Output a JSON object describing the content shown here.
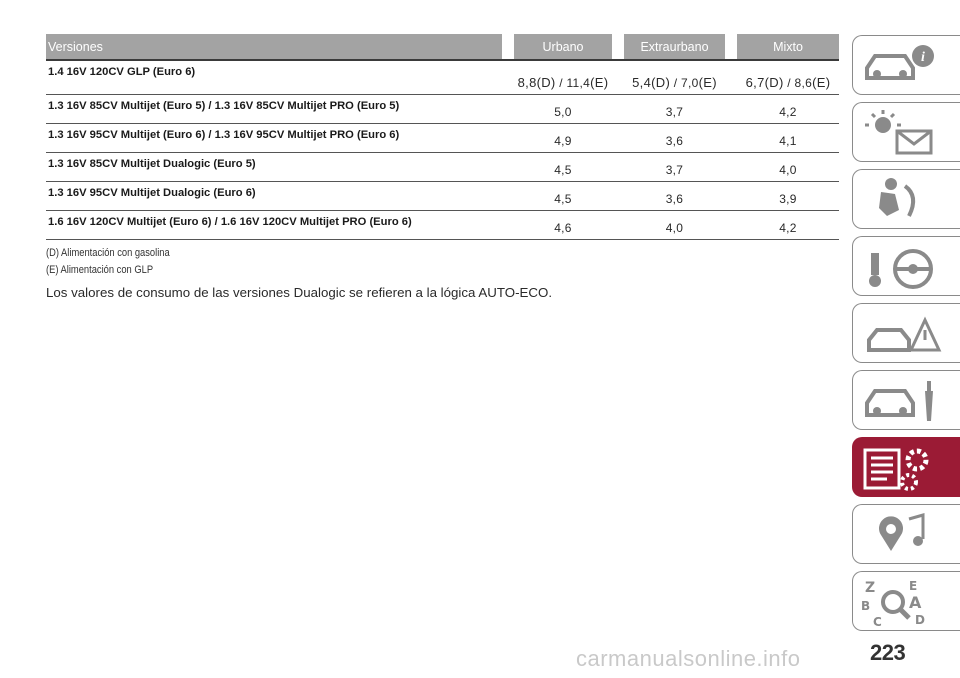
{
  "table": {
    "headers": [
      "Versiones",
      "Urbano",
      "Extraurbano",
      "Mixto"
    ],
    "first_row": {
      "name": "1.4 16V 120CV GLP (Euro 6)",
      "urbano": {
        "v1": "8,8",
        "l1": "(D)",
        "sep": " / ",
        "v2": "11,4",
        "l2": "(E)"
      },
      "extraurbano": {
        "v1": "5,4",
        "l1": "(D)",
        "sep": " / ",
        "v2": "7,0",
        "l2": "(E)"
      },
      "mixto": {
        "v1": "6,7",
        "l1": "(D)",
        "sep": " / ",
        "v2": "8,6",
        "l2": "(E)"
      }
    },
    "rows": [
      {
        "name": "1.3 16V 85CV Multijet (Euro 5) / 1.3 16V 85CV Multijet PRO (Euro 5)",
        "urbano": "5,0",
        "extraurbano": "3,7",
        "mixto": "4,2"
      },
      {
        "name": "1.3 16V 95CV Multijet (Euro 6) / 1.3 16V 95CV Multijet PRO (Euro 6)",
        "urbano": "4,9",
        "extraurbano": "3,6",
        "mixto": "4,1"
      },
      {
        "name": "1.3 16V 85CV Multijet Dualogic (Euro 5)",
        "urbano": "4,5",
        "extraurbano": "3,7",
        "mixto": "4,0"
      },
      {
        "name": "1.3 16V 95CV Multijet Dualogic (Euro 6)",
        "urbano": "4,5",
        "extraurbano": "3,6",
        "mixto": "3,9"
      },
      {
        "name": "1.6 16V 120CV Multijet (Euro 6) / 1.6 16V 120CV Multijet PRO (Euro 6)",
        "urbano": "4,6",
        "extraurbano": "4,0",
        "mixto": "4,2"
      }
    ]
  },
  "notes": [
    "(D) Alimentación con gasolina",
    "(E) Alimentación con GLP"
  ],
  "paragraph": "Los valores de consumo de las versiones Dualogic se refieren a la lógica AUTO-ECO.",
  "sidebar": {
    "tabs": [
      {
        "icon": "car-info-icon"
      },
      {
        "icon": "warning-light-message-icon"
      },
      {
        "icon": "seat-airbag-icon"
      },
      {
        "icon": "key-steering-wheel-icon"
      },
      {
        "icon": "car-accident-icon"
      },
      {
        "icon": "car-wrench-icon"
      },
      {
        "icon": "technical-data-icon",
        "active": true
      },
      {
        "icon": "multimedia-icon"
      },
      {
        "icon": "index-search-icon"
      }
    ],
    "active_color": "#9b1b35",
    "border_color": "#8a8a8a"
  },
  "page_number": "223",
  "watermark": "carmanualsonline.info"
}
